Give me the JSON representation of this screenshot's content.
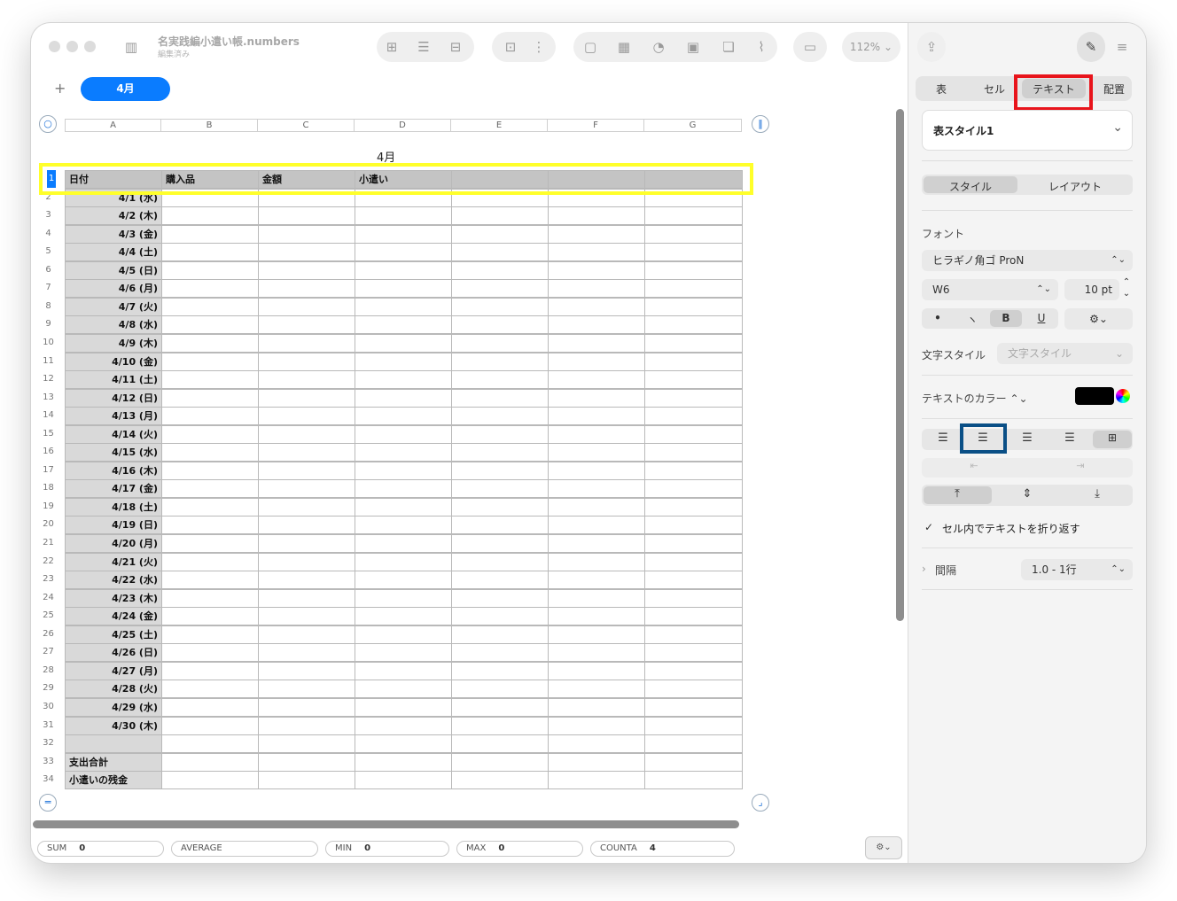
{
  "window": {
    "title": "名実践編小遣い帳.numbers",
    "subtitle": "編集済み",
    "zoom": "112%",
    "zoom_chevron": "⌄"
  },
  "toolbar_icons": {
    "sidebar": "sidebar-icon",
    "insert": "insert-table-icon",
    "list": "list-icon",
    "table": "table-icon",
    "media": "media-icon",
    "shape": "shape-icon",
    "chart": "chart-icon",
    "text": "text-icon",
    "copy": "duplicate-icon",
    "attach": "paperclip-icon",
    "comment": "comment-icon",
    "share": "share-icon",
    "format": "format-brush-icon",
    "organize": "organize-icon"
  },
  "sheets": {
    "add_label": "+",
    "active_tab": "4月"
  },
  "table": {
    "title": "4月",
    "columns": [
      "A",
      "B",
      "C",
      "D",
      "E",
      "F",
      "G"
    ],
    "header_row": [
      "日付",
      "購入品",
      "金額",
      "小遣い",
      "",
      "",
      ""
    ],
    "dates": [
      "4/1 (水)",
      "4/2 (木)",
      "4/3 (金)",
      "4/4 (土)",
      "4/5 (日)",
      "4/6 (月)",
      "4/7 (火)",
      "4/8 (水)",
      "4/9 (木)",
      "4/10 (金)",
      "4/11 (土)",
      "4/12 (日)",
      "4/13 (月)",
      "4/14 (火)",
      "4/15 (水)",
      "4/16 (木)",
      "4/17 (金)",
      "4/18 (土)",
      "4/19 (日)",
      "4/20 (月)",
      "4/21 (火)",
      "4/22 (水)",
      "4/23 (木)",
      "4/24 (金)",
      "4/25 (土)",
      "4/26 (日)",
      "4/27 (月)",
      "4/28 (火)",
      "4/29 (水)",
      "4/30 (木)"
    ],
    "footer_rows": [
      "支出合計",
      "小遣いの残金"
    ],
    "row_numbers": [
      "1",
      "2",
      "3",
      "4",
      "5",
      "6",
      "7",
      "8",
      "9",
      "10",
      "11",
      "12",
      "13",
      "14",
      "15",
      "16",
      "17",
      "18",
      "19",
      "20",
      "21",
      "22",
      "23",
      "24",
      "25",
      "26",
      "27",
      "28",
      "29",
      "30",
      "31",
      "32",
      "33",
      "34"
    ]
  },
  "status_bar": {
    "sum_label": "SUM",
    "sum_value": "0",
    "average_label": "AVERAGE",
    "min_label": "MIN",
    "min_value": "0",
    "max_label": "MAX",
    "max_value": "0",
    "counta_label": "COUNTA",
    "counta_value": "4"
  },
  "inspector": {
    "tabs": [
      "表",
      "セル",
      "テキスト",
      "配置"
    ],
    "active_tab": "テキスト",
    "paragraph_style": "表スタイル1",
    "subtabs": [
      "スタイル",
      "レイアウト"
    ],
    "font_label": "フォント",
    "font_family": "ヒラギノ角ゴ ProN",
    "font_weight": "W6",
    "font_size": "10 pt",
    "format_buttons": [
      "•",
      "ヽ",
      "B",
      "U"
    ],
    "char_style_label": "文字スタイル",
    "char_style_value": "文字スタイル",
    "text_color_label": "テキストのカラー ⌃⌄",
    "text_color": "#000000",
    "wrap_label": "セル内でテキストを折り返す",
    "wrap_checked": true,
    "spacing_label": "間隔",
    "spacing_value": "1.0 - 1行",
    "highlight_colors": {
      "tab_box": "#e8141b",
      "align_box": "#0a4f86",
      "row_box": "#ffff2a"
    }
  }
}
